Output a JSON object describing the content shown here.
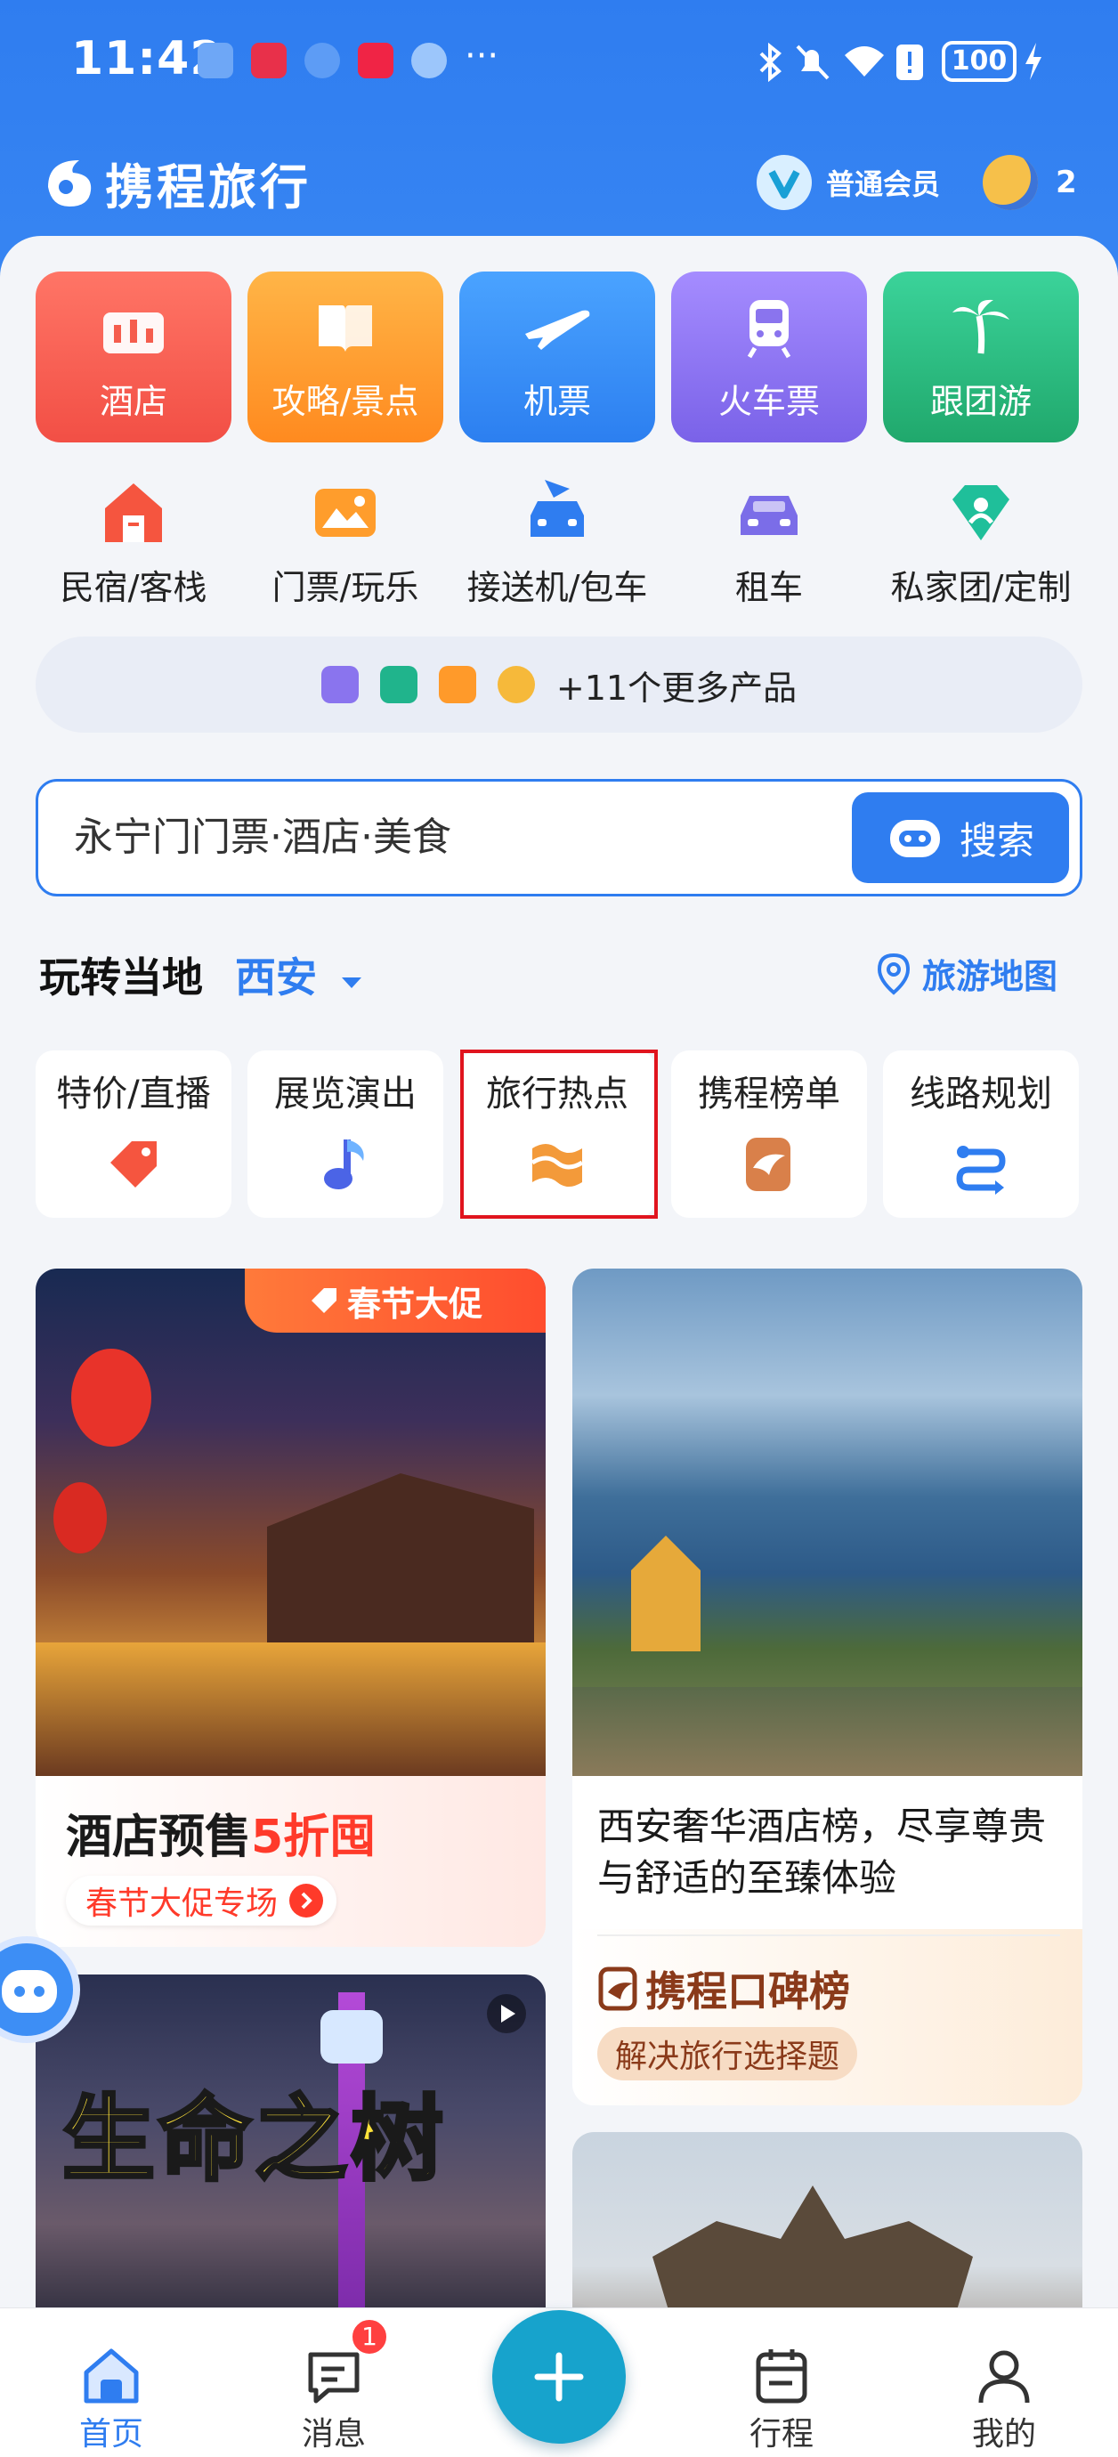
{
  "status_bar": {
    "time": "11:42",
    "battery": "100"
  },
  "header": {
    "logo_text": "携程旅行",
    "member_label": "普通会员",
    "coins_count": "2"
  },
  "main_tiles": [
    {
      "label": "酒店",
      "color": "#f55d4d"
    },
    {
      "label": "攻略/景点",
      "color": "#ff9d2c"
    },
    {
      "label": "机票",
      "color": "#2f8bf2"
    },
    {
      "label": "火车票",
      "color": "#8a74ee"
    },
    {
      "label": "跟团游",
      "color": "#29b97c"
    }
  ],
  "sub_services": [
    {
      "label": "民宿/客栈"
    },
    {
      "label": "门票/玩乐"
    },
    {
      "label": "接送机/包车"
    },
    {
      "label": "租车"
    },
    {
      "label": "私家团/定制"
    }
  ],
  "more_products": "+11个更多产品",
  "search": {
    "placeholder": "永宁门门票·酒店·美食",
    "button_label": "搜索"
  },
  "local": {
    "title": "玩转当地",
    "city": "西安",
    "map_link": "旅游地图"
  },
  "categories": [
    {
      "label": "特价/直播"
    },
    {
      "label": "展览演出"
    },
    {
      "label": "旅行热点"
    },
    {
      "label": "携程榜单"
    },
    {
      "label": "线路规划"
    }
  ],
  "feed": {
    "card1": {
      "badge": "春节大促",
      "headline_a": "酒店预售",
      "headline_b": "5折囤",
      "cta": "春节大促专场"
    },
    "card2": {
      "title": "西安奢华酒店榜，尽享尊贵与舒适的至臻体验",
      "brand": "携程口碑榜",
      "tag": "解决旅行选择题"
    },
    "card3": {
      "overlay_text": "生命之树"
    }
  },
  "bottom_nav": [
    {
      "label": "首页"
    },
    {
      "label": "消息",
      "badge": "1"
    },
    {
      "label": "行程"
    },
    {
      "label": "我的"
    }
  ],
  "colors": {
    "brand_blue": "#2f7df0",
    "highlight_red": "#e0141e",
    "fab_teal": "#17a3cc"
  }
}
